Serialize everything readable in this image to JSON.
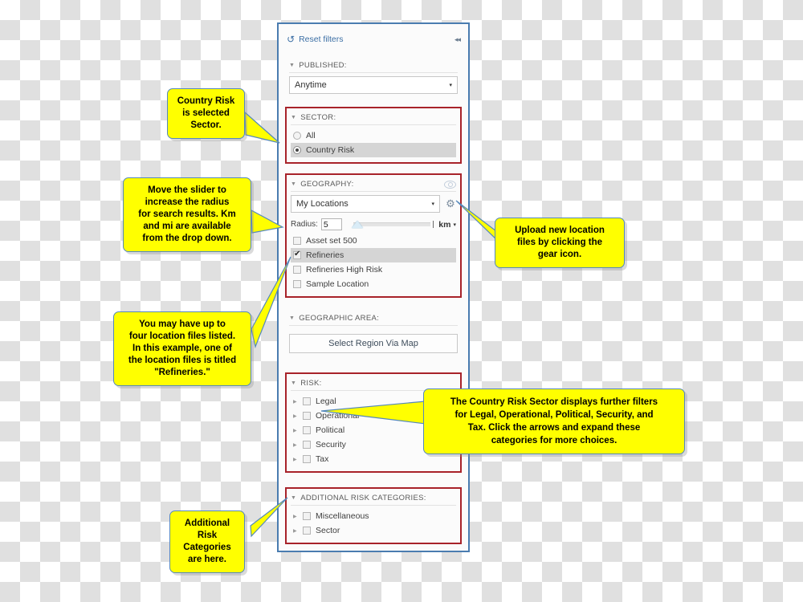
{
  "panel": {
    "reset": {
      "label": "Reset filters",
      "icon": "reset-arrow-icon"
    },
    "collapse_icon": "◂◂",
    "sections": {
      "published": {
        "title": "PUBLISHED:",
        "select_value": "Anytime",
        "caret": "▾"
      },
      "sector": {
        "title": "SECTOR:",
        "options": [
          {
            "label": "All",
            "selected": false
          },
          {
            "label": "Country Risk",
            "selected": true
          }
        ]
      },
      "geography": {
        "title": "GEOGRAPHY:",
        "eye_icon": "visibility-icon",
        "select_value": "My Locations",
        "gear_icon": "gear-icon",
        "radius_label": "Radius:",
        "radius_value": "5",
        "unit_value": "km",
        "caret": "▾",
        "location_files": [
          {
            "label": "Asset set 500",
            "checked": false,
            "highlighted": false
          },
          {
            "label": "Refineries",
            "checked": true,
            "highlighted": true
          },
          {
            "label": "Refineries High Risk",
            "checked": false,
            "highlighted": false
          },
          {
            "label": "Sample Location",
            "checked": false,
            "highlighted": false
          }
        ]
      },
      "geographic_area": {
        "title": "GEOGRAPHIC AREA:",
        "button_label": "Select Region Via Map"
      },
      "risk": {
        "title": "RISK:",
        "items": [
          {
            "label": "Legal",
            "checked": false
          },
          {
            "label": "Operational",
            "checked": false
          },
          {
            "label": "Political",
            "checked": false
          },
          {
            "label": "Security",
            "checked": false
          },
          {
            "label": "Tax",
            "checked": false
          }
        ]
      },
      "additional_risk": {
        "title": "ADDITIONAL RISK CATEGORIES:",
        "items": [
          {
            "label": "Miscellaneous",
            "checked": false
          },
          {
            "label": "Sector",
            "checked": false
          }
        ]
      }
    }
  },
  "callouts": {
    "sector": "Country Risk\nis selected\nSector.",
    "slider": "Move the slider to\nincrease the radius\nfor search results. Km\nand mi are available\nfrom the drop down.",
    "location_files": "You may have up to\nfour location files listed.\nIn this example, one of\nthe location files is titled\n\"Refineries.\"",
    "additional": "Additional\nRisk\nCategories\nare here.",
    "gear": "Upload new location\nfiles by clicking the\ngear icon.",
    "risk": "The Country Risk Sector displays further filters\nfor Legal, Operational, Political, Security, and\nTax. Click the arrows and expand these\ncategories for more choices."
  },
  "colors": {
    "callout_fill": "#ffff00",
    "callout_border": "#5588bb",
    "section_highlight_border": "#a8232a",
    "panel_border": "#4a7cb0",
    "link": "#3c6fa5"
  }
}
